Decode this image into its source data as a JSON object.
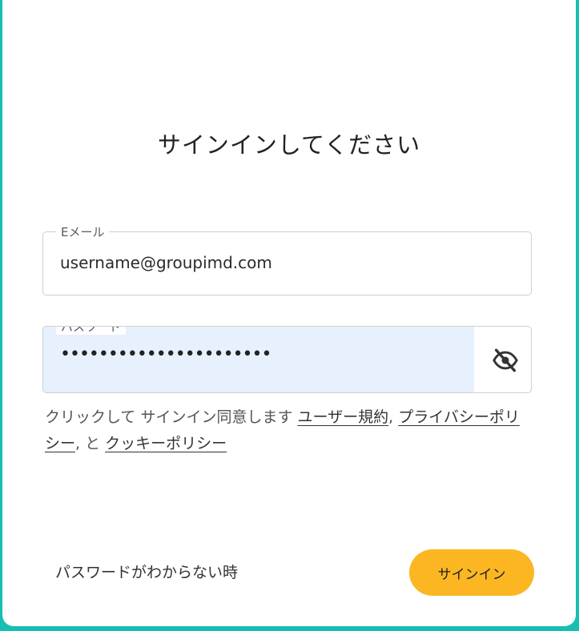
{
  "page_title": "サインインしてください",
  "email_field": {
    "label": "Eメール",
    "value": "username@groupimd.com"
  },
  "password_field": {
    "label": "パスワード",
    "masked_value": "••••••••••••••••••••••",
    "toggle_icon": "eye-off-icon"
  },
  "consent": {
    "prefix": "クリックして サインイン同意します ",
    "terms_link": "ユーザー規約",
    "sep1": ", ",
    "privacy_link": "プライバシーポリシー",
    "sep2": ", と ",
    "cookie_link": "クッキーポリシー"
  },
  "forgot_password_link": "パスワードがわからない時",
  "signin_button": "サインイン",
  "colors": {
    "background": "#17bfb3",
    "card": "#ffffff",
    "button": "#fbb622",
    "password_fill": "#e7f0fd"
  }
}
